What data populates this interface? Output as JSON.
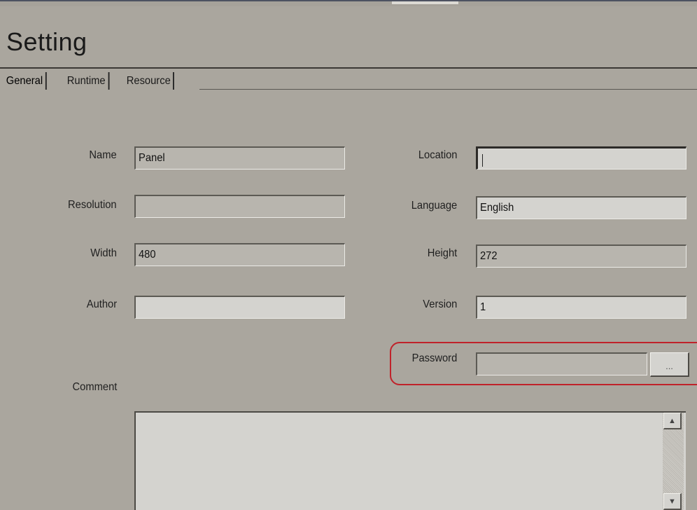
{
  "page_title": "Setting",
  "tabs": [
    {
      "label": "General",
      "active": true
    },
    {
      "label": "Runtime",
      "active": false
    },
    {
      "label": "Resource",
      "active": false
    }
  ],
  "fields": {
    "name": {
      "label": "Name",
      "value": "Panel"
    },
    "location": {
      "label": "Location",
      "value": ""
    },
    "resolution": {
      "label": "Resolution",
      "value": ""
    },
    "language": {
      "label": "Language",
      "value": "English"
    },
    "width": {
      "label": "Width",
      "value": "480"
    },
    "height": {
      "label": "Height",
      "value": "272"
    },
    "author": {
      "label": "Author",
      "value": ""
    },
    "version": {
      "label": "Version",
      "value": "1"
    },
    "password": {
      "label": "Password",
      "value": "",
      "button_label": "..."
    },
    "comment": {
      "label": "Comment",
      "value": ""
    }
  },
  "icons": {
    "scroll_up": "scroll-up-arrow-icon",
    "scroll_down": "scroll-down-arrow-icon"
  },
  "colors": {
    "highlight": "#c0222a",
    "background": "#aaa69e"
  }
}
